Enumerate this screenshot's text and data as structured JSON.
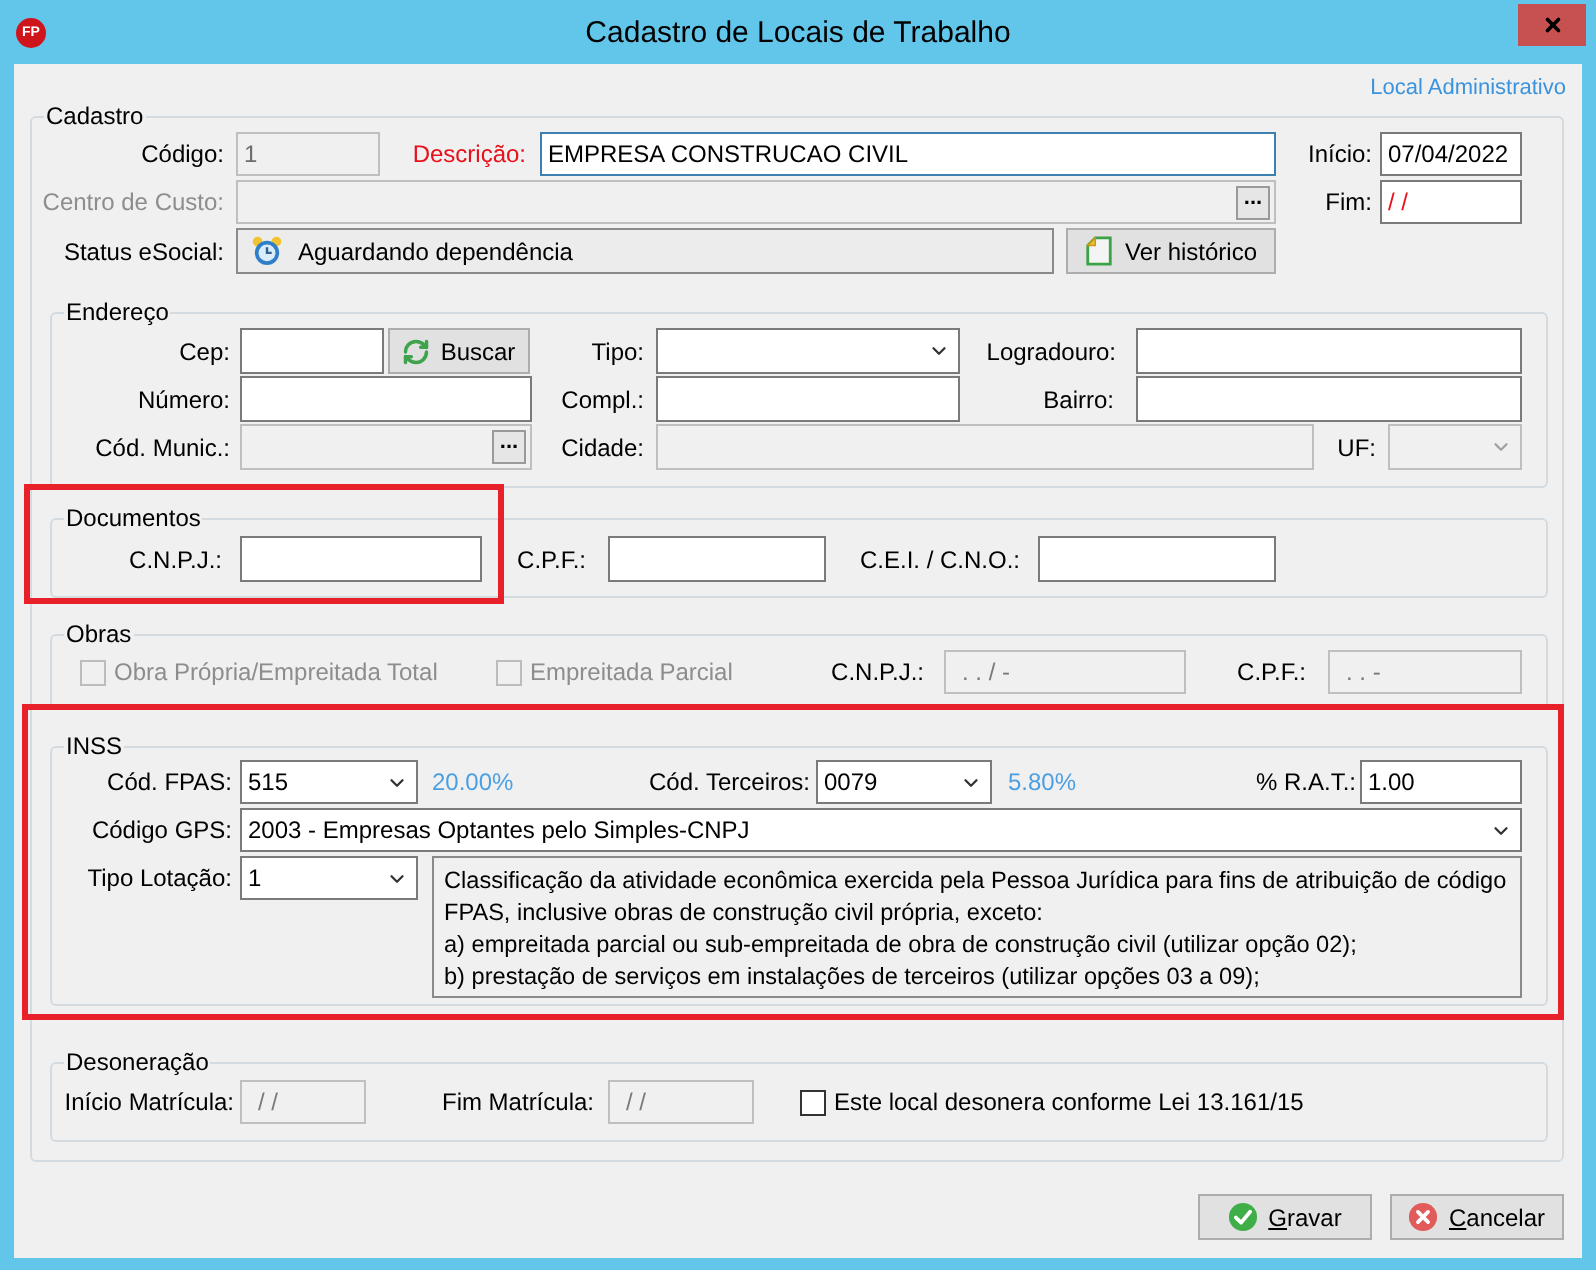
{
  "window": {
    "icon_label": "FP",
    "title": "Cadastro de Locais de Trabalho"
  },
  "link": "Local Administrativo",
  "cadastro": {
    "title": "Cadastro",
    "codigo": {
      "label": "Código:",
      "value": "1",
      "disabled": true
    },
    "descricao": {
      "label": "Descrição:",
      "value": "EMPRESA CONSTRUCAO CIVIL",
      "required": true,
      "focused": true
    },
    "inicio": {
      "label": "Início:",
      "value": "07/04/2022"
    },
    "centro_de_custo": {
      "label": "Centro de Custo:",
      "disabled": true,
      "browse_button": "..."
    },
    "fim": {
      "label": "Fim:",
      "value": "/ /",
      "invalid": true
    },
    "status_esocial": {
      "label": "Status eSocial:",
      "value": "Aguardando dependência"
    },
    "history_button": "Ver histórico"
  },
  "endereco": {
    "title": "Endereço",
    "cep": {
      "label": "Cep:"
    },
    "search_button": "Buscar",
    "tipo": {
      "label": "Tipo:"
    },
    "logradouro": {
      "label": "Logradouro:"
    },
    "numero": {
      "label": "Número:"
    },
    "compl": {
      "label": "Compl.:"
    },
    "bairro": {
      "label": "Bairro:"
    },
    "cod_munic": {
      "label": "Cód. Munic.:",
      "disabled": true,
      "browse_button": "..."
    },
    "cidade": {
      "label": "Cidade:",
      "disabled": true
    },
    "uf": {
      "label": "UF:",
      "disabled": true
    }
  },
  "documentos": {
    "title": "Documentos",
    "highlighted": true,
    "fields": [
      {
        "label": "C.N.P.J.:"
      },
      {
        "label": "C.P.F.:"
      },
      {
        "label": "C.E.I. / C.N.O.:"
      }
    ]
  },
  "obras": {
    "title": "Obras",
    "checkboxes": [
      {
        "label": "Obra Própria/Empreitada Total",
        "checked": false,
        "disabled": true
      },
      {
        "label": "Empreitada Parcial",
        "checked": false,
        "disabled": true
      }
    ],
    "cnpj": {
      "label": "C.N.P.J.:",
      "placeholder": ". . / -",
      "disabled": true
    },
    "cpf": {
      "label": "C.P.F.:",
      "placeholder": ". . -",
      "disabled": true
    }
  },
  "inss": {
    "title": "INSS",
    "highlighted": true,
    "cod_fpas": {
      "label": "Cód. FPAS:",
      "value": "515",
      "rate": "20.00%"
    },
    "cod_terceiros": {
      "label": "Cód. Terceiros:",
      "value": "0079",
      "rate": "5.80%"
    },
    "rat": {
      "label": "% R.A.T.:",
      "value": "1.00"
    },
    "codigo_gps": {
      "label": "Código GPS:",
      "value": "2003  - Empresas Optantes pelo Simples-CNPJ"
    },
    "tipo_lotacao": {
      "label": "Tipo Lotação:",
      "value": "1"
    },
    "description": "Classificação da atividade econômica exercida pela Pessoa Jurídica para fins de atribuição de código\nFPAS, inclusive obras de construção civil própria, exceto:\na) empreitada parcial ou sub-empreitada de obra de construção civil (utilizar opção 02);\nb) prestação de serviços em instalações de terceiros (utilizar opções 03 a 09);"
  },
  "desoneracao": {
    "title": "Desoneração",
    "inicio_matricula": {
      "label": "Início Matrícula:",
      "placeholder": "/ /",
      "disabled": true
    },
    "fim_matricula": {
      "label": "Fim Matrícula:",
      "placeholder": "/ /",
      "disabled": true
    },
    "checkbox": {
      "label": "Este local desonera conforme Lei 13.161/15",
      "checked": false
    }
  },
  "buttons": [
    {
      "label": "Gravar",
      "kind": "save"
    },
    {
      "label": "Cancelar",
      "kind": "cancel"
    }
  ]
}
